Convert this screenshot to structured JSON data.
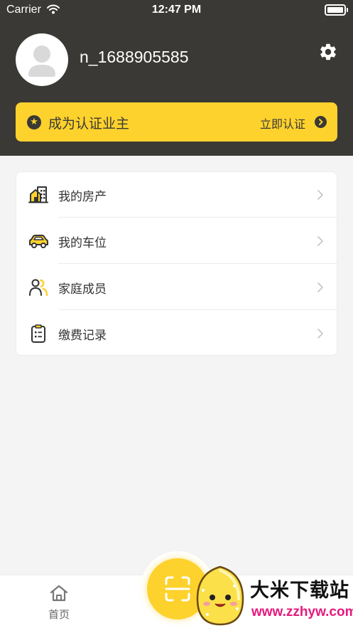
{
  "status_bar": {
    "carrier": "Carrier",
    "time": "12:47 PM"
  },
  "profile": {
    "username": "n_1688905585"
  },
  "certification": {
    "title": "成为认证业主",
    "action": "立即认证"
  },
  "menu": [
    {
      "label": "我的房产",
      "icon": "building-icon"
    },
    {
      "label": "我的车位",
      "icon": "car-icon"
    },
    {
      "label": "家庭成员",
      "icon": "family-members-icon"
    },
    {
      "label": "缴费记录",
      "icon": "clipboard-icon"
    }
  ],
  "tabbar": {
    "home_label": "首页"
  },
  "watermark": {
    "title": "大米下载站",
    "url": "www.zzhyw.com"
  },
  "colors": {
    "header_bg": "#3b3935",
    "accent_yellow": "#fdd22d",
    "page_bg": "#f4f4f4",
    "watermark_url": "#e5197d"
  }
}
